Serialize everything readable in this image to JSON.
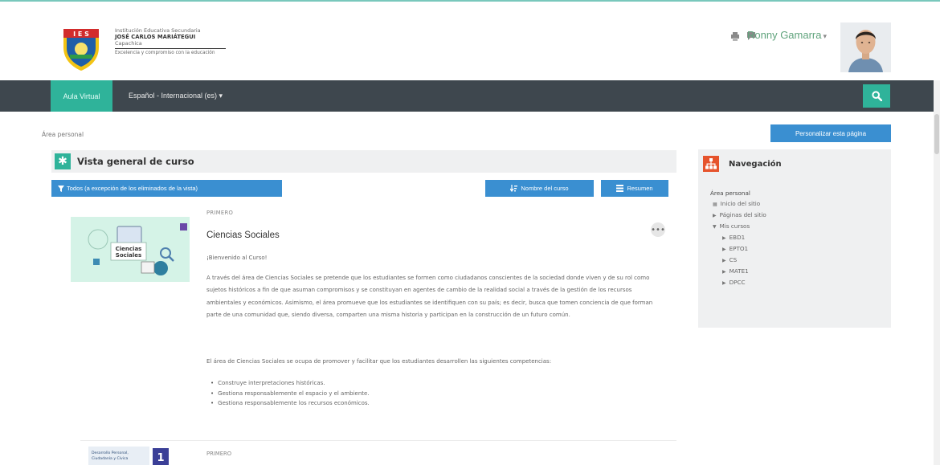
{
  "header": {
    "institution": {
      "line1": "Institución Educativa Secundaria",
      "line2": "JOSÉ CARLOS MARIÁTEGUI",
      "line3": "Capachica",
      "line4": "Excelencia y compromiso con la educación"
    },
    "logo_text": "I E S",
    "user_name": "Ronny Gamarra",
    "user_caret": "▾"
  },
  "navbar": {
    "brand": "Aula Virtual",
    "language": "Español - Internacional (es) ▾"
  },
  "breadcrumb": "Área personal",
  "customize_button": "Personalizar esta página",
  "overview": {
    "title": "Vista general de curso",
    "filter_button": "Todos (a excepción de los eliminados de la vista)",
    "sort_button": "Nombre del curso",
    "view_button": "Resumen",
    "courses": [
      {
        "category": "PRIMERO",
        "name": "Ciencias Sociales",
        "image_text": "Ciencias Sociales",
        "welcome": "¡Bienvenido al Curso!",
        "description": "A través del área de Ciencias Sociales se pretende que los estudiantes se formen como ciudadanos conscientes de la sociedad donde viven y de su rol como sujetos históricos a fin de que asuman compromisos y se constituyan en agentes de cambio de la realidad social a través de la gestión de los recursos ambientales y económicos. Asimismo, el área promueve que los estudiantes se identifiquen con su país; es decir, busca que tomen conciencia de que forman parte de una comunidad que, siendo diversa, comparten una misma historia y participan en la construcción de un futuro común.",
        "description2": "El área de Ciencias Sociales se ocupa de promover y facilitar que los estudiantes desarrollen las siguientes competencias:",
        "competencies": [
          "Construye interpretaciones históricas.",
          "Gestiona responsablemente el espacio y el ambiente.",
          "Gestiona responsablemente los recursos económicos."
        ]
      },
      {
        "category": "PRIMERO",
        "image_text": "Desarrollo Personal, Ciudadanía y Cívica"
      }
    ]
  },
  "navigation": {
    "title": "Navegación",
    "root": "Área personal",
    "items": [
      "Inicio del sitio",
      "Páginas del sitio",
      "Mis cursos"
    ],
    "my_courses": [
      "EBD1",
      "EPTO1",
      "CS",
      "MATE1",
      "DPCC"
    ]
  },
  "colors": {
    "accent": "#2fb39a",
    "navbar": "#3e474e",
    "button": "#3a8fd1",
    "user_link": "#5fa37c",
    "nav_icon": "#e6542d"
  },
  "icons": {
    "header": [
      "print-icon",
      "chat-icon"
    ],
    "search": "search-icon",
    "overview": "asterisk-icon",
    "navigation": "sitemap-icon"
  }
}
